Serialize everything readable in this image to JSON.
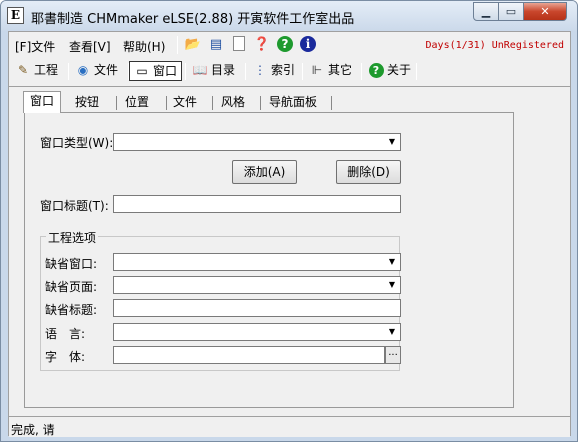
{
  "window": {
    "app_icon": "E",
    "title": "耶書制造 CHMmaker eLSE(2.88) 开寅软件工作室出品"
  },
  "menubar": {
    "items": [
      "[F]文件",
      "查看[V]",
      "帮助(H)"
    ],
    "registration": "Days(1/31) UnRegistered",
    "toolbar_icons": [
      "open-folder-icon",
      "window-list-icon",
      "new-page-icon",
      "help-page-icon",
      "help-question-icon",
      "info-icon"
    ]
  },
  "navbar": {
    "items": [
      {
        "label": "工程",
        "icon": "project-icon"
      },
      {
        "label": "文件",
        "icon": "file-globe-icon"
      },
      {
        "label": "窗口",
        "icon": "window-icon"
      },
      {
        "label": "目录",
        "icon": "contents-book-icon"
      },
      {
        "label": "索引",
        "icon": "index-icon"
      },
      {
        "label": "其它",
        "icon": "other-icon"
      },
      {
        "label": "关于",
        "icon": "about-icon"
      }
    ]
  },
  "tabs": [
    "窗口",
    "按钮",
    "位置",
    "文件",
    "风格",
    "导航面板"
  ],
  "form": {
    "window_type_label": "窗口类型(W):",
    "window_type_value": "",
    "add_button": "添加(A)",
    "delete_button": "删除(D)",
    "window_title_label": "窗口标题(T):",
    "window_title_value": ""
  },
  "project_options": {
    "group_title": "工程选项",
    "default_window_label": "缺省窗口:",
    "default_window_value": "",
    "default_page_label": "缺省页面:",
    "default_page_value": "",
    "default_title_label": "缺省标题:",
    "default_title_value": "",
    "language_label": "语　言:",
    "language_value": "",
    "font_label": "字　体:",
    "font_value": "",
    "browse_button": "..."
  },
  "status": {
    "text": "完成, 请"
  }
}
